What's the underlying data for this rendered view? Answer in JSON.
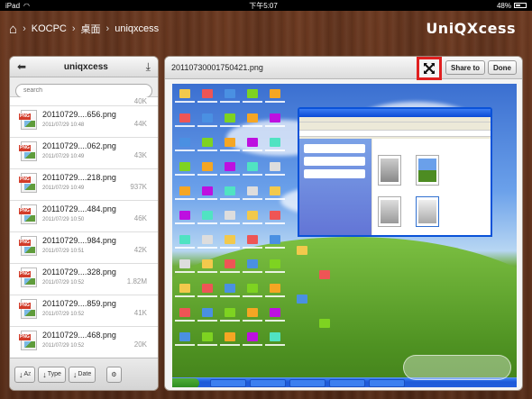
{
  "status_bar": {
    "device": "iPad",
    "wifi_icon": "wifi-icon",
    "time": "下午5:07",
    "battery": "48%"
  },
  "nav": {
    "home_icon": "home-icon",
    "breadcrumbs": [
      "KOCPC",
      "桌面",
      "uniqxcess"
    ],
    "brand": "UniQXcess"
  },
  "file_panel": {
    "title": "uniqxcess",
    "search_placeholder": "search",
    "partial_top_size": "40K",
    "files": [
      {
        "name": "20110729....656.png",
        "date": "2011/07/29 10:48",
        "size": "44K"
      },
      {
        "name": "20110729....062.png",
        "date": "2011/07/29 10:49",
        "size": "43K"
      },
      {
        "name": "20110729....218.png",
        "date": "2011/07/29 10:49",
        "size": "937K"
      },
      {
        "name": "20110729....484.png",
        "date": "2011/07/29 10:50",
        "size": "46K"
      },
      {
        "name": "20110729....984.png",
        "date": "2011/07/29 10:51",
        "size": "42K"
      },
      {
        "name": "20110729....328.png",
        "date": "2011/07/29 10:52",
        "size": "1.82M"
      },
      {
        "name": "20110729....859.png",
        "date": "2011/07/29 10:52",
        "size": "41K"
      },
      {
        "name": "20110729....468.png",
        "date": "2011/07/29 10:52",
        "size": "20K"
      }
    ],
    "sort_buttons": [
      "Type",
      "Date"
    ]
  },
  "preview": {
    "filename": "20110730001750421.png",
    "share_label": "Share to",
    "done_label": "Done"
  }
}
